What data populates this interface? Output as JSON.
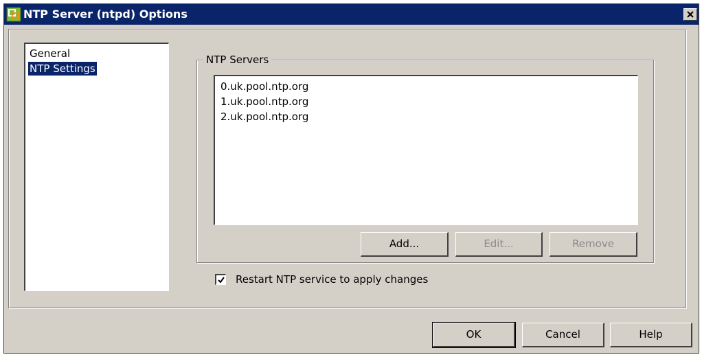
{
  "window": {
    "title": "NTP Server (ntpd) Options",
    "icons": {
      "app": "vsphere-app-icon",
      "close": "close-icon"
    }
  },
  "nav": {
    "items": [
      {
        "label": "General",
        "selected": false
      },
      {
        "label": "NTP Settings",
        "selected": true
      }
    ]
  },
  "ntp_servers": {
    "group_label": "NTP Servers",
    "servers": [
      "0.uk.pool.ntp.org",
      "1.uk.pool.ntp.org",
      "2.uk.pool.ntp.org"
    ],
    "buttons": {
      "add": "Add...",
      "edit": "Edit...",
      "remove": "Remove"
    },
    "button_states": {
      "add": "enabled",
      "edit": "disabled",
      "remove": "disabled"
    }
  },
  "restart_option": {
    "label": "Restart NTP service to apply changes",
    "checked": true
  },
  "footer": {
    "ok": "OK",
    "cancel": "Cancel",
    "help": "Help"
  },
  "colors": {
    "title_bar": "#0a246a",
    "dialog_face": "#d4d0c8",
    "selection": "#0a246a",
    "disabled_text": "#8a8a8a",
    "app_icon_orange": "#f08a24",
    "app_icon_green": "#7bbf3a"
  }
}
